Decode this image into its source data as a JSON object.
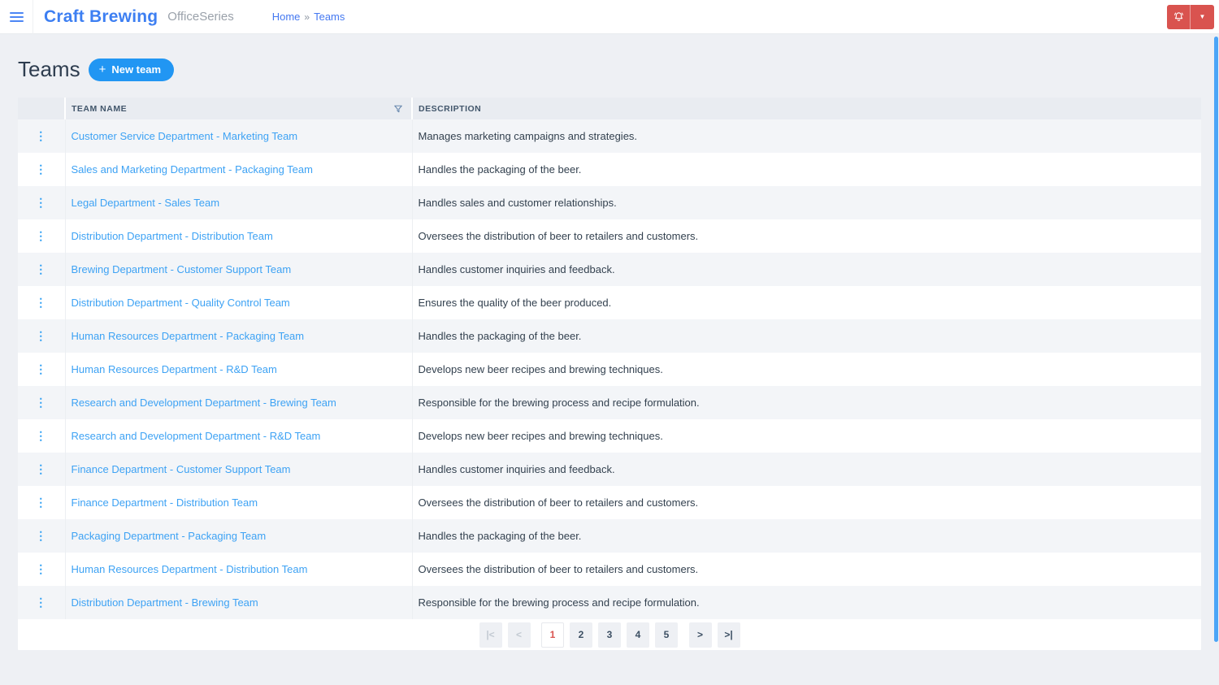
{
  "colors": {
    "accent_blue": "#2196f3",
    "link_blue": "#3da2f4",
    "brand_blue": "#3d7ff2",
    "danger_red": "#d9534f",
    "page_bg": "#eef0f4",
    "table_header_bg": "#e9ecf1",
    "row_alt_bg": "#f3f5f8",
    "scrollbar_blue": "#4ba5f7"
  },
  "header": {
    "brand": "Craft Brewing",
    "suffix": "OfficeSeries",
    "breadcrumb": {
      "home": "Home",
      "separator": "»",
      "current": "Teams"
    },
    "icons": {
      "menu": "hamburger-icon",
      "notifications": "bell-icon",
      "account": "caret-down-icon",
      "caret_glyph": "▼"
    }
  },
  "page": {
    "title": "Teams",
    "new_team": {
      "plus_glyph": "+",
      "label": "New team"
    }
  },
  "table": {
    "columns": {
      "team_name": "TEAM NAME",
      "description": "DESCRIPTION"
    },
    "filter_icon": "funnel-icon",
    "row_menu_icon_glyph": "⋮",
    "rows": [
      {
        "name": "Customer Service Department - Marketing Team",
        "description": "Manages marketing campaigns and strategies."
      },
      {
        "name": "Sales and Marketing Department - Packaging Team",
        "description": "Handles the packaging of the beer."
      },
      {
        "name": "Legal Department - Sales Team",
        "description": "Handles sales and customer relationships."
      },
      {
        "name": "Distribution Department - Distribution Team",
        "description": "Oversees the distribution of beer to retailers and customers."
      },
      {
        "name": "Brewing Department - Customer Support Team",
        "description": "Handles customer inquiries and feedback."
      },
      {
        "name": "Distribution Department - Quality Control Team",
        "description": "Ensures the quality of the beer produced."
      },
      {
        "name": "Human Resources Department - Packaging Team",
        "description": "Handles the packaging of the beer."
      },
      {
        "name": "Human Resources Department - R&D Team",
        "description": "Develops new beer recipes and brewing techniques."
      },
      {
        "name": "Research and Development Department - Brewing Team",
        "description": "Responsible for the brewing process and recipe formulation."
      },
      {
        "name": "Research and Development Department - R&D Team",
        "description": "Develops new beer recipes and brewing techniques."
      },
      {
        "name": "Finance Department - Customer Support Team",
        "description": "Handles customer inquiries and feedback."
      },
      {
        "name": "Finance Department - Distribution Team",
        "description": "Oversees the distribution of beer to retailers and customers."
      },
      {
        "name": "Packaging Department - Packaging Team",
        "description": "Handles the packaging of the beer."
      },
      {
        "name": "Human Resources Department - Distribution Team",
        "description": "Oversees the distribution of beer to retailers and customers."
      },
      {
        "name": "Distribution Department - Brewing Team",
        "description": "Responsible for the brewing process and recipe formulation."
      }
    ]
  },
  "pagination": {
    "items": [
      {
        "data_name": "first-page-button",
        "glyph": "|<",
        "state": "disabled",
        "extra": ""
      },
      {
        "data_name": "previous-page-button",
        "glyph": "<",
        "state": "disabled",
        "extra": ""
      },
      {
        "data_name": "page-1-button",
        "glyph": "1",
        "state": "active",
        "extra": "gap-left"
      },
      {
        "data_name": "page-2-button",
        "glyph": "2",
        "state": "default",
        "extra": ""
      },
      {
        "data_name": "page-3-button",
        "glyph": "3",
        "state": "default",
        "extra": ""
      },
      {
        "data_name": "page-4-button",
        "glyph": "4",
        "state": "default",
        "extra": ""
      },
      {
        "data_name": "page-5-button",
        "glyph": "5",
        "state": "default",
        "extra": ""
      },
      {
        "data_name": "next-page-button",
        "glyph": ">",
        "state": "default",
        "extra": "gap-left"
      },
      {
        "data_name": "last-page-button",
        "glyph": ">|",
        "state": "default",
        "extra": ""
      }
    ]
  }
}
